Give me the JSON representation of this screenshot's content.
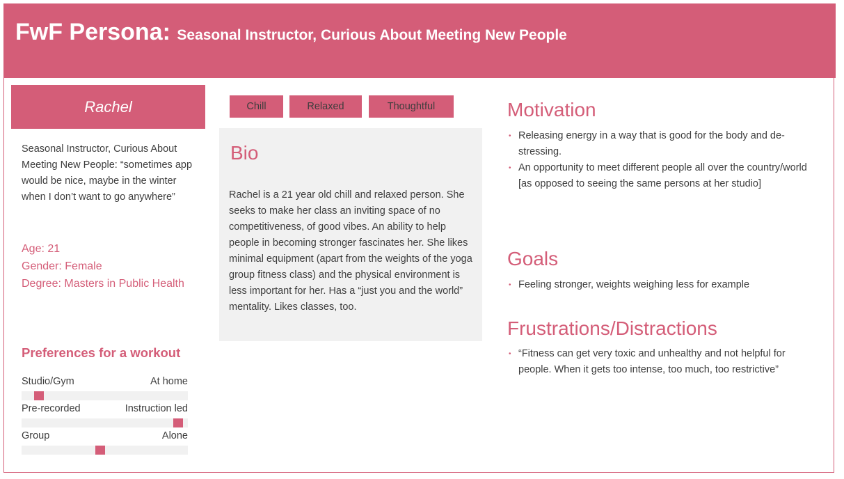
{
  "header": {
    "title": "FwF Persona:",
    "subtitle": "Seasonal Instructor, Curious About Meeting New People"
  },
  "persona": {
    "name": "Rachel",
    "quote": "Seasonal Instructor, Curious About Meeting New People: “sometimes app would be nice, maybe in the winter when I don’t want to go anywhere”",
    "age_label": "Age:",
    "age": "21",
    "gender_label": "Gender:",
    "gender": "Female",
    "degree_label": "Degree:",
    "degree": "Masters in Public Health"
  },
  "preferences": {
    "title": "Preferences for a workout",
    "items": [
      {
        "left": "Studio/Gym",
        "right": "At home",
        "level": 0.08
      },
      {
        "left": "Pre-recorded",
        "right": "Instruction led",
        "level": 0.97
      },
      {
        "left": "Group",
        "right": "Alone",
        "level": 0.47
      }
    ]
  },
  "traits": [
    "Chill",
    "Relaxed",
    "Thoughtful"
  ],
  "bio": {
    "title": "Bio",
    "text": "Rachel is a 21 year old chill and relaxed person. She seeks to make her class an inviting space of no competitiveness, of good vibes. An ability to help people in becoming stronger fascinates her. She likes minimal equipment (apart from the weights of the yoga group fitness class) and the physical environment is less important for her. Has a “just you and the world” mentality. Likes classes, too."
  },
  "motivation": {
    "title": "Motivation",
    "items": [
      "Releasing energy in a way that is good for the body and de-stressing.",
      "An opportunity to meet different people all over the country/world [as opposed to seeing the same persons at her studio]"
    ]
  },
  "goals": {
    "title": "Goals",
    "items": [
      "Feeling stronger, weights weighing less for example"
    ]
  },
  "frustrations": {
    "title": "Frustrations/Distractions",
    "items": [
      "“Fitness can get very toxic and unhealthy and not helpful for people. When it gets too intense, too much, too restrictive”"
    ]
  },
  "colors": {
    "accent": "#d45d78",
    "panel": "#f1f1f1",
    "text": "#3d3d3d"
  },
  "icons": {
    "bullet": "•"
  }
}
